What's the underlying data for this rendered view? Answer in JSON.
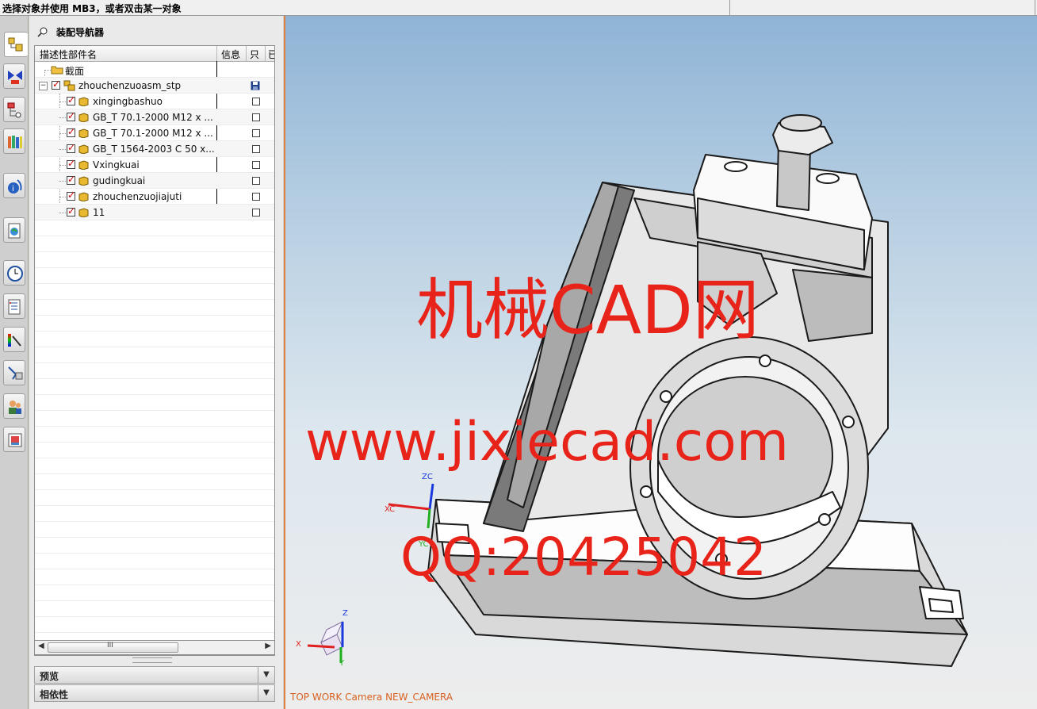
{
  "status_bar": {
    "prompt": "选择对象并使用 MB3，或者双击某一对象"
  },
  "resource_bar": {
    "icons": [
      "assembly-navigator-icon",
      "constraint-navigator-icon",
      "part-navigator-icon",
      "reuse-library-icon",
      "hd3d-tools-icon",
      "web-browser-icon",
      "history-icon",
      "process-studio-icon",
      "visualization-icon",
      "manufacturing-wizard-icon",
      "roles-icon",
      "system-materials-icon"
    ]
  },
  "navigator": {
    "title": "装配导航器",
    "columns": {
      "name": "描述性部件名",
      "info": "信息",
      "readonly": "只",
      "extra": "已"
    },
    "section_node": "截面",
    "root": {
      "label": "zhouchenzuoasm_stp"
    },
    "children": [
      {
        "label": "xingingbashuo"
      },
      {
        "label": "GB_T 70.1-2000 M12 x ..."
      },
      {
        "label": "GB_T 70.1-2000 M12 x ..."
      },
      {
        "label": "GB_T 1564-2003 C 50 x..."
      },
      {
        "label": "Vxingkuai"
      },
      {
        "label": "gudingkuai"
      },
      {
        "label": "zhouchenzuojiajuti"
      },
      {
        "label": "11"
      }
    ],
    "hscroll_thumb": "III",
    "panels": {
      "preview": "预览",
      "dependency": "相依性"
    }
  },
  "viewport": {
    "view_label": "TOP WORK Camera NEW_CAMERA",
    "wcs": {
      "xc": "XC",
      "yc": "YC",
      "zc": "ZC"
    },
    "abs": {
      "x": "X",
      "y": "Y",
      "z": "Z"
    },
    "watermark": {
      "line1": "机械CAD网",
      "line2": "www.jixiecad.com",
      "line3": "QQ:20425042"
    }
  },
  "colors": {
    "viewport_border": "#e08040",
    "check_mark": "#d00000",
    "watermark": "#e8241a",
    "view_label": "#d86020"
  }
}
